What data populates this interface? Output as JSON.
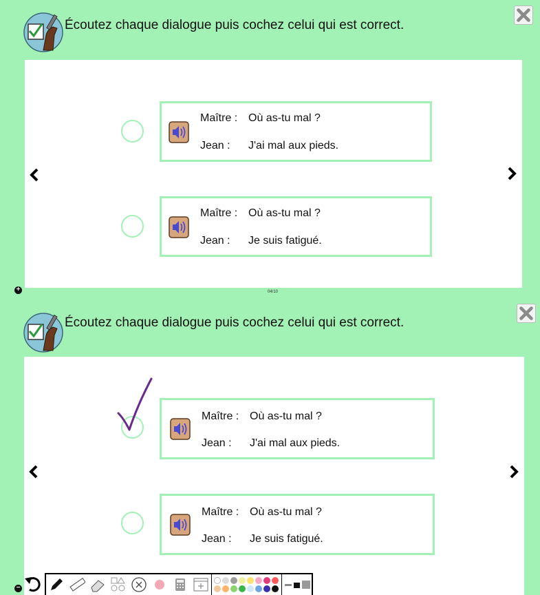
{
  "instruction": "Écoutez chaque dialogue puis cochez celui qui est correct.",
  "page_indicator": "04/10",
  "dialogues": [
    {
      "speaker1": "Maître :",
      "line1": "Où as-tu mal ?",
      "speaker2": "Jean :",
      "line2": "J'ai mal aux pieds."
    },
    {
      "speaker1": "Maître :",
      "line1": "Où as-tu mal ?",
      "speaker2": "Jean :",
      "line2": "Je suis fatigué."
    }
  ],
  "colors": {
    "accent_green": "#a2f1b5",
    "check_stroke": "#6a2a8c"
  },
  "icons": {
    "close": "close-icon",
    "prev": "chevron-left-icon",
    "next": "chevron-right-icon",
    "audio": "speaker-icon"
  },
  "toolbar": {
    "tools": [
      "pencil-icon",
      "ruler-icon",
      "eraser-icon",
      "shapes-icon",
      "clear-icon",
      "record-dot-icon",
      "calculator-icon",
      "add-frame-icon"
    ],
    "palette": [
      "#ffffff",
      "#dcdcdc",
      "#9e9e9e",
      "#f1f1a0",
      "#ffe36b",
      "#f7a8c4",
      "#e33b7c",
      "#ff5a5a",
      "#f3c89c",
      "#ffb36b",
      "#8bd36b",
      "#3bb54a",
      "#cfe9f7",
      "#6ba6e3",
      "#3b2fb0",
      "#111111"
    ]
  }
}
